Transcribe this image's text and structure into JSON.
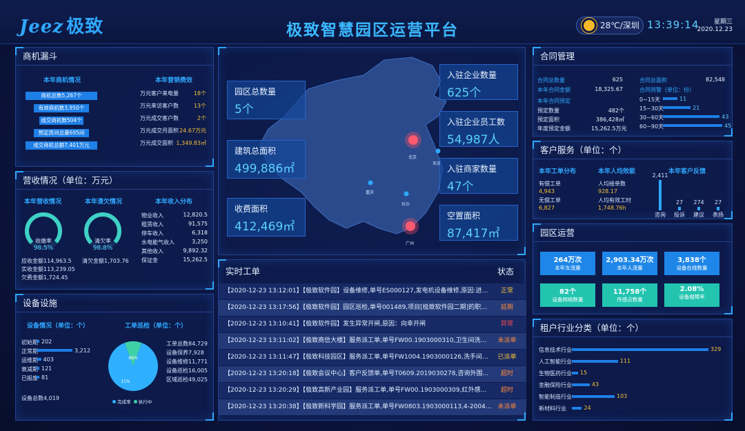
{
  "header": {
    "logo": "Jeez",
    "logo_cn": "极致",
    "title": "极致智慧园区运营平台",
    "weather": "28℃/深圳",
    "time": "13:39:14",
    "weekday": "星期三",
    "date": "2020.12.23"
  },
  "funnel": {
    "title": "商机漏斗",
    "left_title": "本年商机情况",
    "right_title": "本年营销费效",
    "stages": [
      "商机总数5,267个",
      "有效商机数3,950个",
      "成交商机数504个",
      "预定房间总量695间",
      "成交商机总额7,401万元"
    ],
    "metrics": [
      {
        "label": "万元客户来电量",
        "value": "18个"
      },
      {
        "label": "万元来访客户数",
        "value": "13个"
      },
      {
        "label": "万元成交客户数",
        "value": "2个"
      },
      {
        "label": "万元成交月面积",
        "value": "24.67万元"
      },
      {
        "label": "万元成交面积",
        "value": "1,349.83㎡"
      }
    ]
  },
  "revenue": {
    "title": "营收情况（单位：万元）",
    "t1": "本年营收情况",
    "t2": "本年清欠情况",
    "t3": "本年收入分布",
    "g1_label": "收缴率",
    "g1_value": "98.5%",
    "g1_pct": 98.5,
    "g2_label": "清欠率",
    "g2_value": "98.8%",
    "g2_pct": 98.8,
    "left_stats": [
      {
        "label": "应收金额",
        "value": "114,963.5"
      },
      {
        "label": "实收金额",
        "value": "113,239.05"
      },
      {
        "label": "欠费金额",
        "value": "1,724.45"
      }
    ],
    "mid_stats": [
      {
        "label": "清欠金额",
        "value": "1,703.76"
      }
    ],
    "dist": [
      {
        "label": "物业收入",
        "value": "12,820.5"
      },
      {
        "label": "租赁收入",
        "value": "91,575"
      },
      {
        "label": "停车收入",
        "value": "6,318"
      },
      {
        "label": "水电能气收入",
        "value": "3,250"
      },
      {
        "label": "其他收入",
        "value": "9,892.32"
      },
      {
        "label": "保证金",
        "value": "15,262.5"
      }
    ]
  },
  "equipment": {
    "title": "设备设施",
    "t1": "设备情况（单位：个）",
    "t2": "工单巡检（单位：个）",
    "bars": [
      {
        "label": "初始期",
        "value": 202
      },
      {
        "label": "正常期",
        "value": 3212
      },
      {
        "label": "运维期",
        "value": 403
      },
      {
        "label": "衰减期",
        "value": 121
      },
      {
        "label": "已报废",
        "value": 81
      }
    ],
    "bars_text": [
      "202",
      "3,212",
      "403",
      "121",
      "81"
    ],
    "total_label": "设备总数",
    "total_value": "4,019",
    "pie_done": "89%",
    "pie_doing": "11%",
    "pie_done_pct": 89,
    "legend_done": "完成率",
    "legend_doing": "执行中",
    "stats": [
      {
        "label": "工单总数",
        "value": "84,729"
      },
      {
        "label": "设备保养",
        "value": "7,928"
      },
      {
        "label": "设备维修",
        "value": "11,771"
      },
      {
        "label": "设备巡检",
        "value": "16,005"
      },
      {
        "label": "区域巡检",
        "value": "49,025"
      }
    ]
  },
  "map": {
    "cards": [
      {
        "title": "园区总数量",
        "value": "5个"
      },
      {
        "title": "建筑总面积",
        "value": "499,886㎡"
      },
      {
        "title": "收费面积",
        "value": "412,469㎡"
      },
      {
        "title": "入驻企业数量",
        "value": "625个"
      },
      {
        "title": "入驻企业员工数",
        "value": "54,987人"
      },
      {
        "title": "入驻商家数量",
        "value": "47个"
      },
      {
        "title": "空置面积",
        "value": "87,417㎡"
      }
    ],
    "cities": [
      "北京",
      "天津",
      "重庆",
      "长沙",
      "广州"
    ]
  },
  "workorders": {
    "title": "实时工单",
    "status_header": "状态",
    "rows": [
      {
        "text": "【2020-12-23 13:12:01】【极致软件园】设备维修,单号ES000127,发电机设备维修,原因:进行设备...",
        "status": "正常",
        "color": "#f5c136"
      },
      {
        "text": "【2020-12-23 13:17:56】【极致软件园】园区巡检,单号001489,项目[极致软件园二期]的职员[郑启...",
        "status": "延期",
        "color": "#ff8a3d"
      },
      {
        "text": "【2020-12-23 13:10:41】【极致软件园】发生异常开闸,原因：向幸开闸",
        "status": "异常",
        "color": "#ff4d4d"
      },
      {
        "text": "【2020-12-23 13:11:02】【极致商信大楼】服务派工单,单号FW00.1903000310,卫生间洗手池堵...",
        "status": "未派单",
        "color": "#ff8a3d"
      },
      {
        "text": "【2020-12-23 13:11:47】【极致科技园区】服务派工单,单号FW1004.1903000126,洗手间扭示牌...",
        "status": "已派单",
        "color": "#f5c136"
      },
      {
        "text": "【2020-12-23 13:20:18】【极致会议中心】客户反馈单,单号T0609.2019030278,咨询外围停车场...",
        "status": "超时",
        "color": "#ff8a3d"
      },
      {
        "text": "【2020-12-23 13:20:29】【极致高新产业园】服务派工单,单号FW00.1903000309,红外感应系统...",
        "status": "超时",
        "color": "#ff8a3d"
      },
      {
        "text": "【2020-12-23 13:20:38】【极致新科学园】服务派工单,单号FW0803.1903000113,4-2004卫生间...",
        "status": "未派单",
        "color": "#ff8a3d"
      }
    ]
  },
  "contract": {
    "title": "合同管理",
    "left": [
      {
        "label": "合同总数量",
        "value": "625"
      },
      {
        "label": "本年合同金额",
        "value": "18,325.67"
      }
    ],
    "forecast_title": "本年合同预定",
    "forecast": [
      {
        "label": "预定数量",
        "value": "482个"
      },
      {
        "label": "预定面积",
        "value": "386,428㎡"
      },
      {
        "label": "年度预定金额",
        "value": "15,262.5万元"
      }
    ],
    "total_label": "合同总面积",
    "total_value": "82,548",
    "warn_title": "合同预警（单位：份）",
    "warn": [
      {
        "label": "0~15天",
        "value": 11
      },
      {
        "label": "15~30天",
        "value": 21
      },
      {
        "label": "30~60天",
        "value": 43
      },
      {
        "label": "60~90天",
        "value": 45
      }
    ]
  },
  "service": {
    "title": "客户服务（单位：个）",
    "t1": "本年工单分布",
    "t2": "本年人均效能",
    "t3": "本年客户反馈",
    "dist": [
      {
        "label": "有偿工单",
        "value": "4,943"
      },
      {
        "label": "无偿工单",
        "value": "6,827"
      }
    ],
    "eff": [
      {
        "label": "人均接单数",
        "value": "928.17"
      },
      {
        "label": "人均有效工时",
        "value": "1,748.76h"
      }
    ],
    "feedback": [
      {
        "label": "咨询",
        "value": 2411,
        "text": "2,411"
      },
      {
        "label": "投诉",
        "value": 27,
        "text": "27"
      },
      {
        "label": "建议",
        "value": 274,
        "text": "274"
      },
      {
        "label": "表扬",
        "value": 27,
        "text": "27"
      }
    ]
  },
  "park": {
    "title": "园区运营",
    "tiles": [
      {
        "big": "264万次",
        "small": "本年车流量"
      },
      {
        "big": "2,903.34万次",
        "small": "本年人流量"
      },
      {
        "big": "3,838个",
        "small": "设备在线数量"
      },
      {
        "big": "82个",
        "small": "设备网络数量"
      },
      {
        "big": "11,758个",
        "small": "传感点数量"
      },
      {
        "big": "2.08%",
        "small": "设备报障率"
      }
    ]
  },
  "industry": {
    "title": "租户行业分类（单位：个）",
    "rows": [
      {
        "label": "信息技术行业",
        "value": 329
      },
      {
        "label": "人工智能行业",
        "value": 111
      },
      {
        "label": "生物医药行业",
        "value": 15
      },
      {
        "label": "金融保险行业",
        "value": 43
      },
      {
        "label": "智能制造行业",
        "value": 103
      },
      {
        "label": "新材料行业",
        "value": 24
      }
    ]
  }
}
